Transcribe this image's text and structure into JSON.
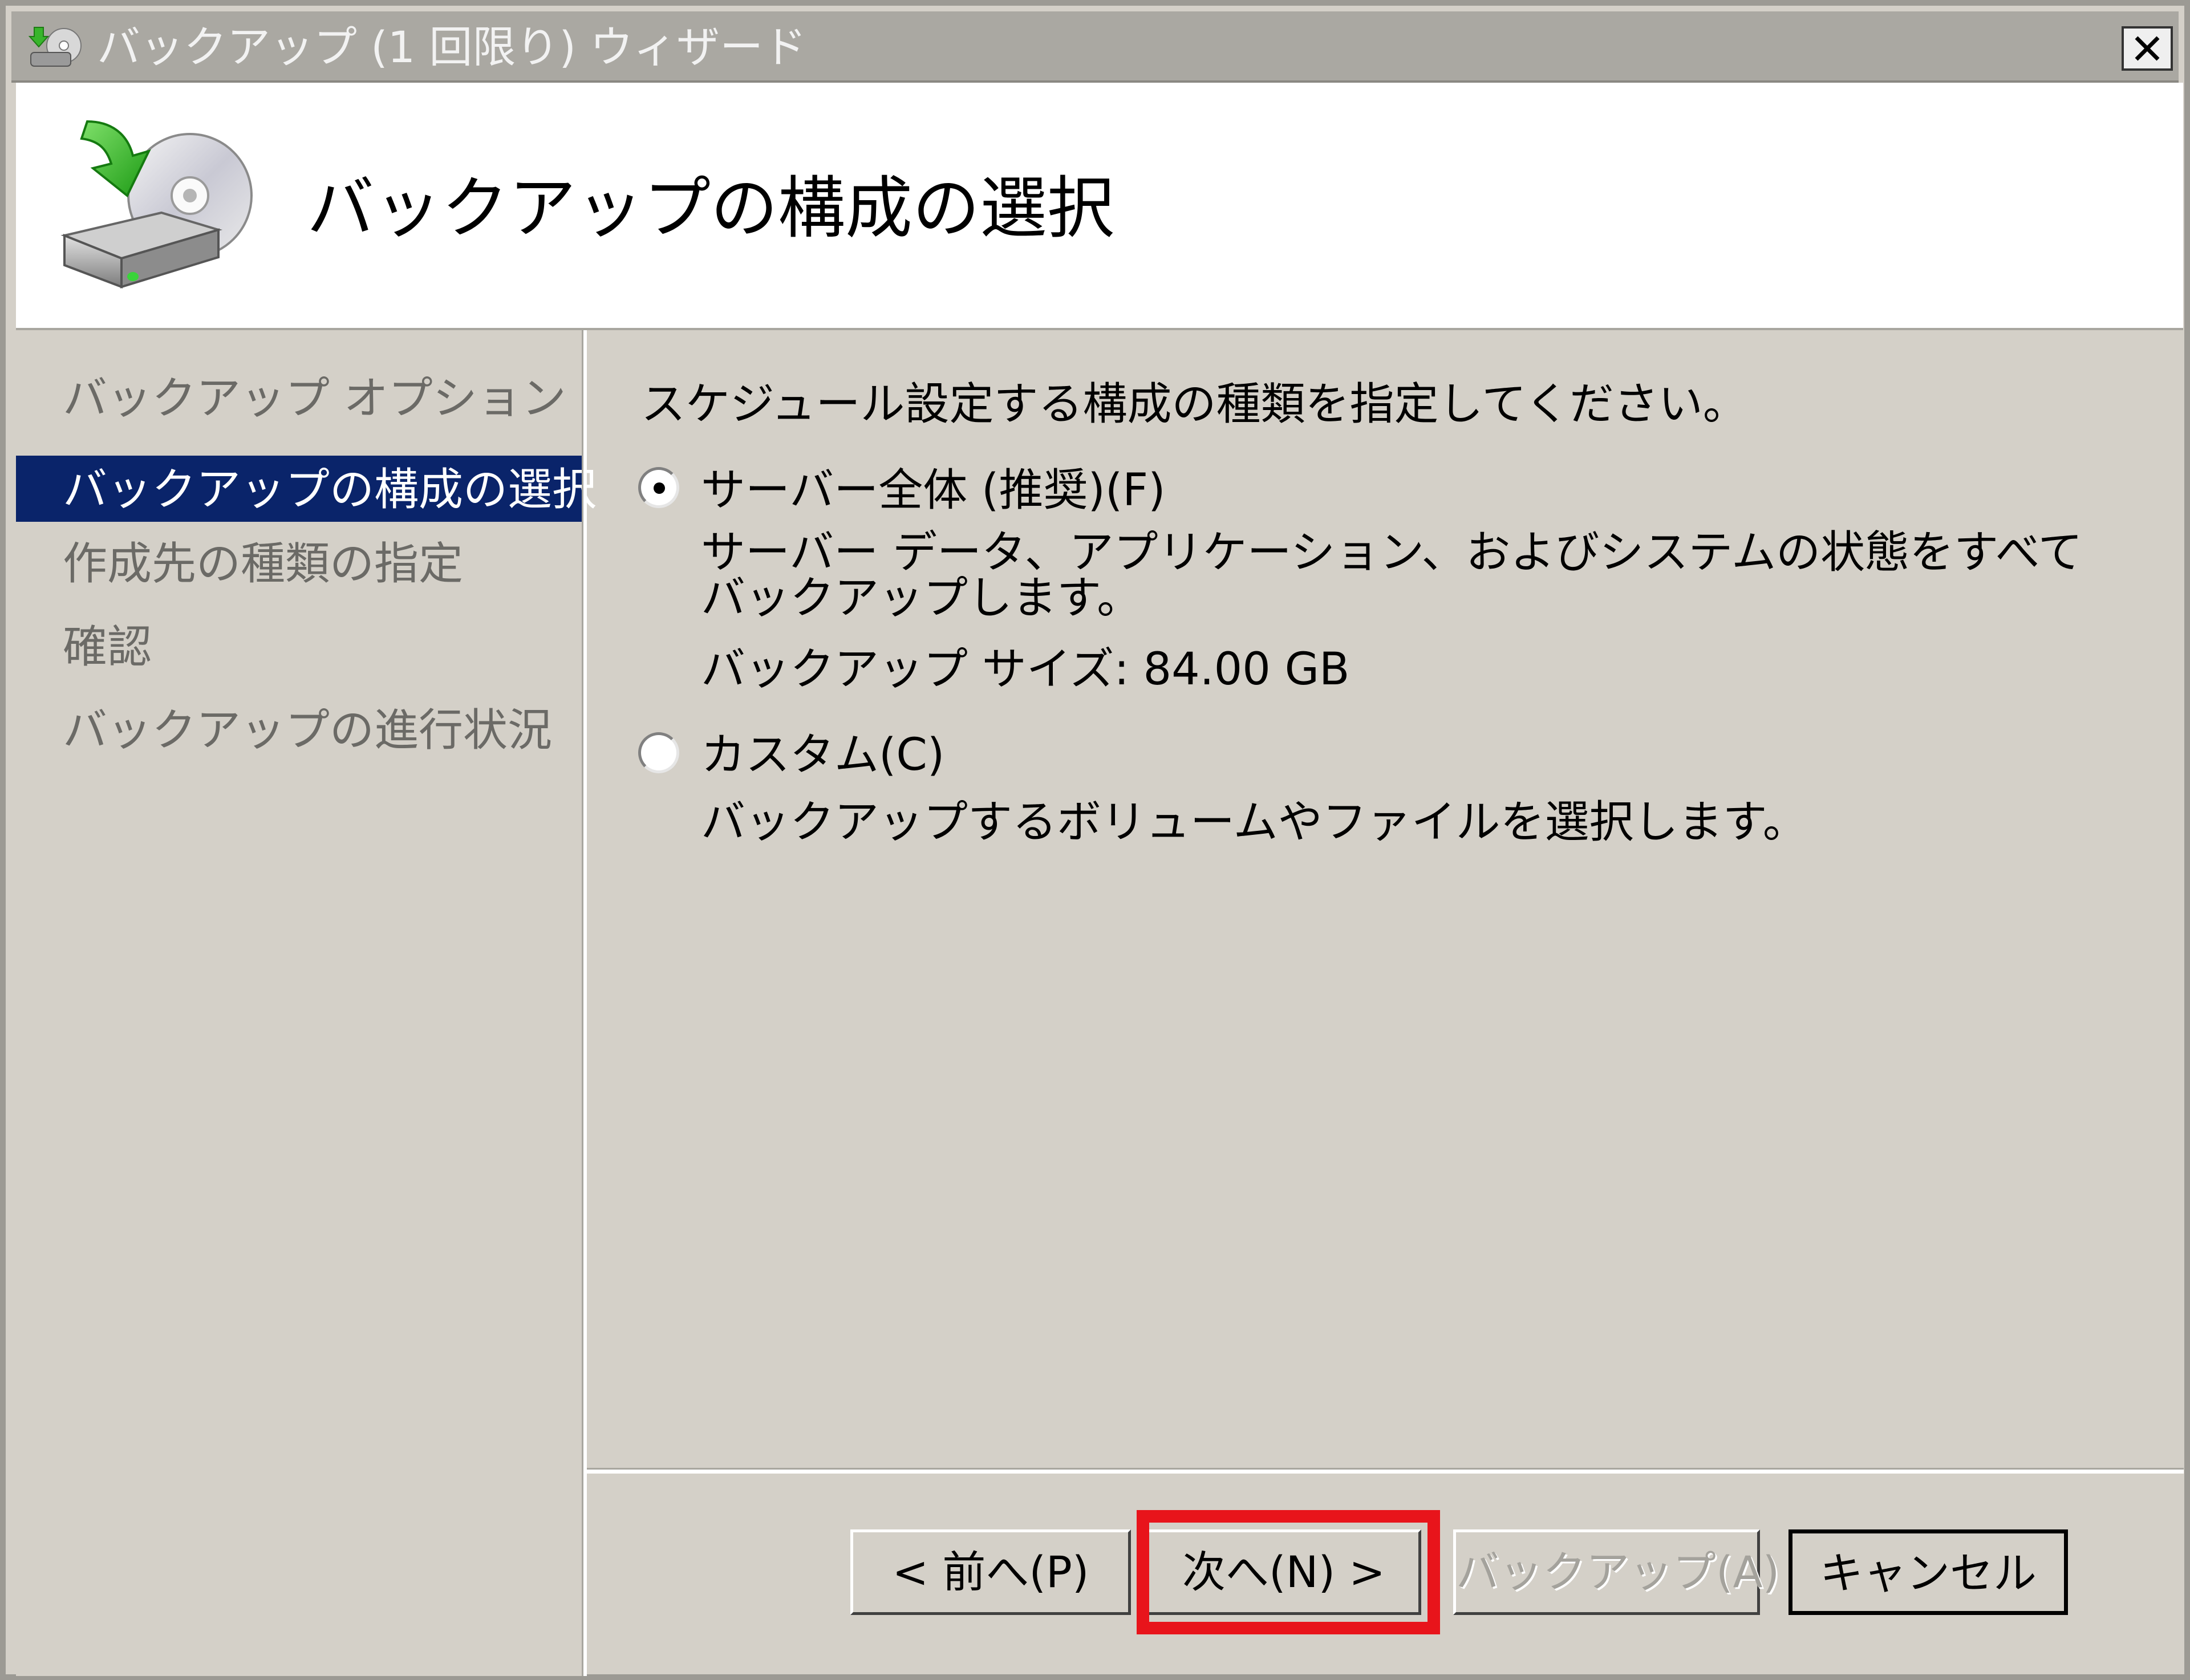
{
  "window": {
    "title": "バックアップ (1 回限り) ウィザード",
    "close_label": "×"
  },
  "header": {
    "title": "バックアップの構成の選択",
    "icon": "backup-disk-icon"
  },
  "sidebar": {
    "items": [
      {
        "label": "バックアップ オプション",
        "active": false
      },
      {
        "label": "バックアップの構成の選択",
        "active": true
      },
      {
        "label": "作成先の種類の指定",
        "active": false
      },
      {
        "label": "確認",
        "active": false
      },
      {
        "label": "バックアップの進行状況",
        "active": false
      }
    ]
  },
  "content": {
    "instruction": "スケジュール設定する構成の種類を指定してください。",
    "options": [
      {
        "label": "サーバー全体 (推奨)(F)",
        "selected": true,
        "description": "サーバー データ、アプリケーション、およびシステムの状態をすべてバックアップします。",
        "size_text": "バックアップ サイズ: 84.00 GB"
      },
      {
        "label": "カスタム(C)",
        "selected": false,
        "description": "バックアップするボリュームやファイルを選択します。"
      }
    ]
  },
  "buttons": {
    "back": "< 前へ(P)",
    "next": "次へ(N) >",
    "backup": "バックアップ(A)",
    "cancel": "キャンセル"
  },
  "colors": {
    "dialog_bg": "#d4d0c8",
    "selection": "#0a246a",
    "highlight": "#e8141b"
  }
}
